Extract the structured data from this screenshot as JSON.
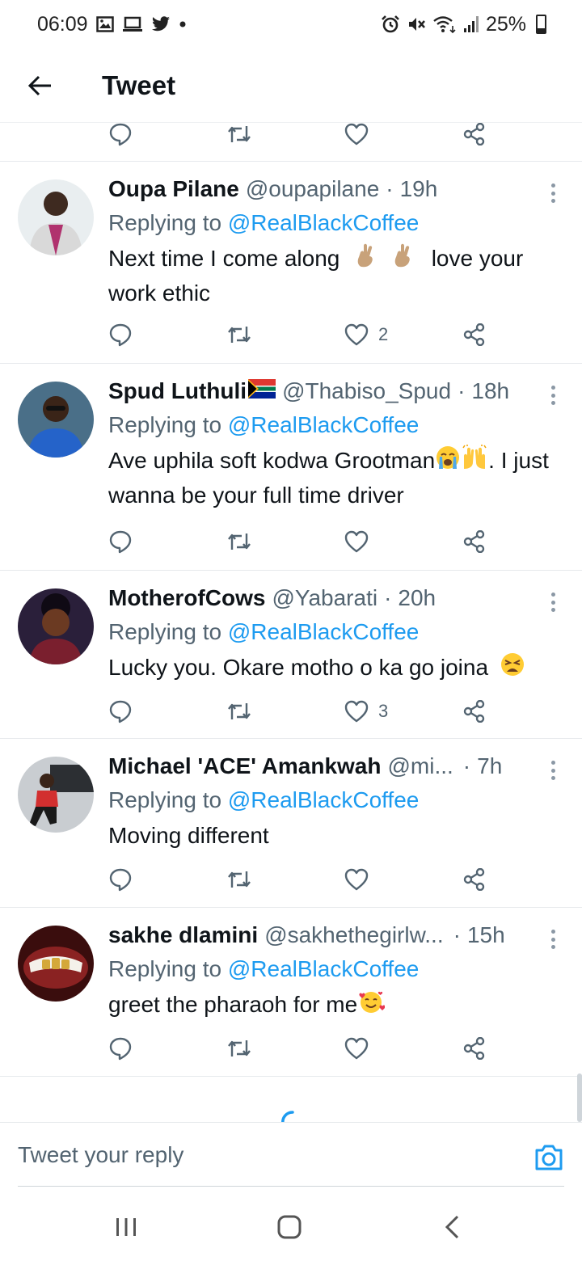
{
  "status_bar": {
    "time": "06:09",
    "battery": "25%",
    "battery_level": 0.25,
    "left_icons": [
      "gallery-icon",
      "laptop-icon",
      "twitter-icon",
      "dot-icon"
    ],
    "right_icons": [
      "alarm-icon",
      "mute-icon",
      "wifi-icon",
      "signal-icon",
      "battery-icon"
    ]
  },
  "header": {
    "title": "Tweet"
  },
  "colors": {
    "accent": "#1d9bf0",
    "text": "#0f1419",
    "secondary": "#536471"
  },
  "top_actions": {
    "reply_count": "",
    "retweet_count": "",
    "like_count": ""
  },
  "tweets": [
    {
      "name": "Oupa Pilane",
      "handle": "@oupapilane",
      "dot": "·",
      "time": "19h",
      "replying_label": "Replying to",
      "replying_to": "@RealBlackCoffee",
      "text_parts": [
        "Next time I come along",
        "love your work ethic"
      ],
      "emojis": [
        "crossed-fingers-emoji",
        "crossed-fingers-emoji"
      ],
      "likes": "2"
    },
    {
      "name": "Spud Luthuli",
      "name_emoji": "south-africa-flag-emoji",
      "handle": "@Thabiso_Spud",
      "dot": "·",
      "time": "18h",
      "replying_label": "Replying to",
      "replying_to": "@RealBlackCoffee",
      "text_parts": [
        "Ave uphila soft kodwa Grootman",
        ". I just wanna be your full time driver"
      ],
      "emojis": [
        "crying-face-emoji",
        "raising-hands-emoji"
      ],
      "likes": ""
    },
    {
      "name": "MotherofCows",
      "handle": "@Yabarati",
      "dot": "·",
      "time": "20h",
      "replying_label": "Replying to",
      "replying_to": "@RealBlackCoffee",
      "text_parts": [
        "Lucky you. Okare motho o ka go joina"
      ],
      "emojis": [
        "weary-face-emoji"
      ],
      "likes": "3"
    },
    {
      "name": "Michael 'ACE' Amankwah",
      "handle": "@mi...",
      "dot": "·",
      "time": "7h",
      "replying_label": "Replying to",
      "replying_to": "@RealBlackCoffee",
      "text_parts": [
        "Moving different"
      ],
      "emojis": [],
      "likes": ""
    },
    {
      "name": "sakhe dlamini",
      "handle": "@sakhethegirlw...",
      "dot": "·",
      "time": "15h",
      "replying_label": "Replying to",
      "replying_to": "@RealBlackCoffee",
      "text_parts": [
        "greet the pharaoh for me"
      ],
      "emojis": [
        "smiling-face-with-hearts-emoji"
      ],
      "likes": ""
    }
  ],
  "reply_bar": {
    "placeholder": "Tweet your reply"
  },
  "nav_bar": {
    "buttons": [
      "recent-apps-icon",
      "home-icon",
      "back-icon"
    ]
  }
}
